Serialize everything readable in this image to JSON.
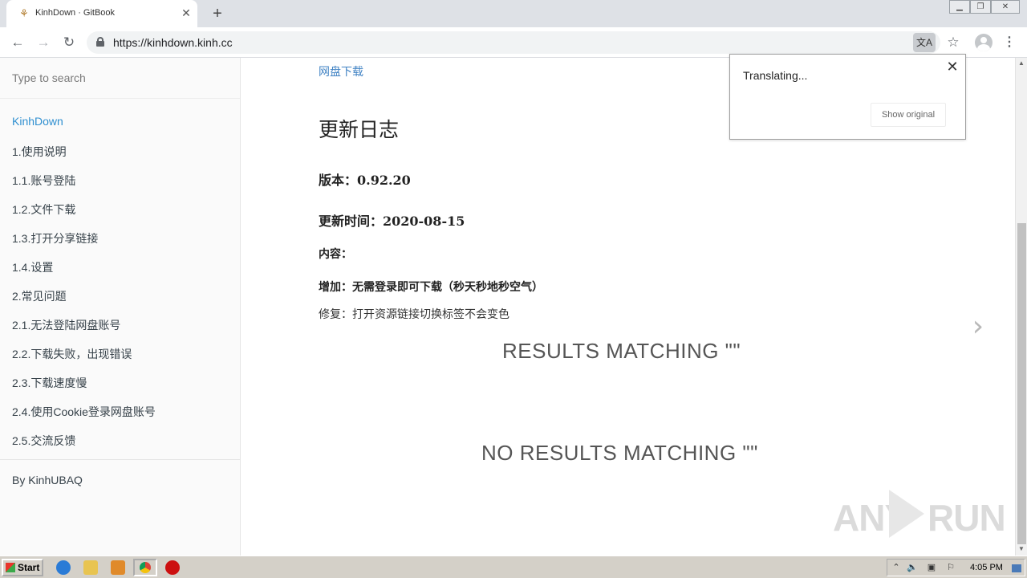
{
  "browser": {
    "tab_title": "KinhDown · GitBook",
    "url": "https://kinhdown.kinh.cc"
  },
  "sidebar": {
    "search_placeholder": "Type to search",
    "items": [
      {
        "label": "KinhDown",
        "active": true
      },
      {
        "label": "1.使用说明"
      },
      {
        "label": "1.1.账号登陆"
      },
      {
        "label": "1.2.文件下载"
      },
      {
        "label": "1.3.打开分享链接"
      },
      {
        "label": "1.4.设置"
      },
      {
        "label": "2.常见问题"
      },
      {
        "label": "2.1.无法登陆网盘账号"
      },
      {
        "label": "2.2.下载失败，出现错误"
      },
      {
        "label": "2.3.下载速度慢"
      },
      {
        "label": "2.4.使用Cookie登录网盘账号"
      },
      {
        "label": "2.5.交流反馈"
      }
    ],
    "footer": "By KinhUBAQ"
  },
  "content": {
    "link": "网盘下载",
    "heading": "更新日志",
    "version": "版本：0.92.20",
    "update_time": "更新时间：2020-08-15",
    "content_label": "内容：",
    "added": "增加：无需登录即可下载（秒天秒地秒空气）",
    "fixed": "修复：打开资源链接切换标签不会变色",
    "results_matching": "RESULTS MATCHING \"\"",
    "no_results_matching": "NO RESULTS MATCHING \"\""
  },
  "translate_popup": {
    "message": "Translating...",
    "show_original": "Show original"
  },
  "watermark": {
    "text_left": "ANY",
    "text_right": "RUN"
  },
  "taskbar": {
    "start_label": "Start",
    "clock": "4:05 PM"
  },
  "colors": {
    "accent_link": "#4183c4",
    "sidebar_active": "#2f8fd0"
  }
}
